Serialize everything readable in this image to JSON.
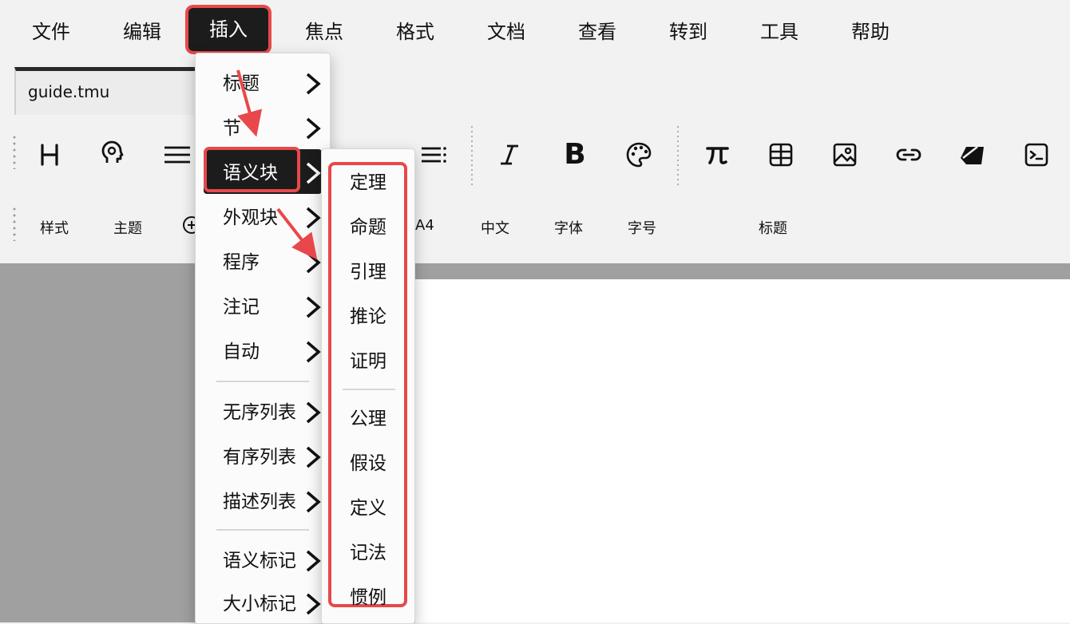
{
  "menubar": {
    "items": [
      "文件",
      "编辑",
      "插入",
      "焦点",
      "格式",
      "文档",
      "查看",
      "转到",
      "工具",
      "帮助"
    ],
    "active": "插入"
  },
  "tab": {
    "title": "guide.tmu"
  },
  "toolbar_row2": {
    "items": [
      "样式",
      "主题",
      "A4",
      "中文",
      "字体",
      "字号",
      "标题"
    ]
  },
  "icons": {
    "row1": [
      "heading-icon",
      "mind-icon",
      "paragraph-icon",
      "block-icon",
      "list-icon",
      "italic-icon",
      "bold-icon",
      "palette-icon",
      "pi-icon",
      "table-icon",
      "image-icon",
      "link-icon",
      "eraser-icon",
      "terminal-icon"
    ],
    "row2": [
      "plus-circle-icon"
    ]
  },
  "insert_menu": {
    "items": [
      "标题",
      "节",
      "语义块",
      "外观块",
      "程序",
      "注记",
      "自动",
      "无序列表",
      "有序列表",
      "描述列表",
      "语义标记",
      "大小标记"
    ],
    "active": "语义块"
  },
  "semantic_submenu": {
    "group1": [
      "定理",
      "命题",
      "引理",
      "推论",
      "证明"
    ],
    "group2": [
      "公理",
      "假设",
      "定义",
      "记法",
      "惯例"
    ]
  },
  "colors": {
    "highlight": "#e8484b",
    "menu_active_bg": "#1c1c1c"
  }
}
